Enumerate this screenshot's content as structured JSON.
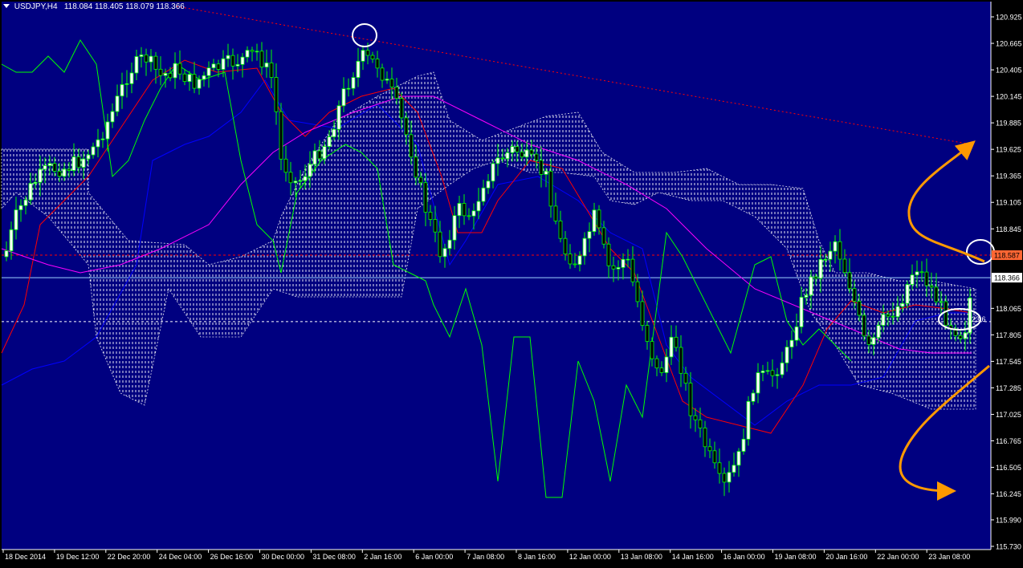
{
  "window": {
    "symbol_label": "USDJPY,H4",
    "ohlc_label": "118.084 118.405 118.079 118.366"
  },
  "colors": {
    "background": "#000080",
    "frame": "#000000",
    "grid_text": "#ffffff",
    "candle_up_body": "#ffffff",
    "candle_down_body": "#000000",
    "candle_wick": "#00ff00",
    "tenkan": "#ff0000",
    "kijun": "#0000ff",
    "chikou": "#00ff00",
    "sma": "#ff00ff",
    "kumo": "#ffffff",
    "resistance_line": "#ff0000",
    "annotation_arrow": "#ff9900",
    "current_price_tag": "#ffffff",
    "marked_price_tag": "#ff6633"
  },
  "price_axis": {
    "ticks": [
      "120.925",
      "120.665",
      "120.405",
      "120.145",
      "119.885",
      "119.625",
      "119.365",
      "119.105",
      "118.845",
      "118.587",
      "118.366",
      "118.065",
      "117.805",
      "117.545",
      "117.285",
      "117.025",
      "116.765",
      "116.505",
      "116.245",
      "115.990",
      "115.730"
    ],
    "current_price": "118.366",
    "marked_price": "118.587",
    "horizontal_dotted": "117.935"
  },
  "time_axis": {
    "labels": [
      "18 Dec 2014",
      "19 Dec 12:00",
      "22 Dec 20:00",
      "24 Dec 04:00",
      "26 Dec 16:00",
      "30 Dec 00:00",
      "31 Dec 08:00",
      "2 Jan 16:00",
      "6 Jan 00:00",
      "7 Jan 08:00",
      "8 Jan 16:00",
      "12 Jan 00:00",
      "13 Jan 08:00",
      "14 Jan 16:00",
      "16 Jan 00:00",
      "19 Jan 08:00",
      "20 Jan 16:00",
      "22 Jan 00:00",
      "23 Jan 08:00"
    ]
  },
  "annotations": {
    "ellipse_label": "23.6"
  }
}
